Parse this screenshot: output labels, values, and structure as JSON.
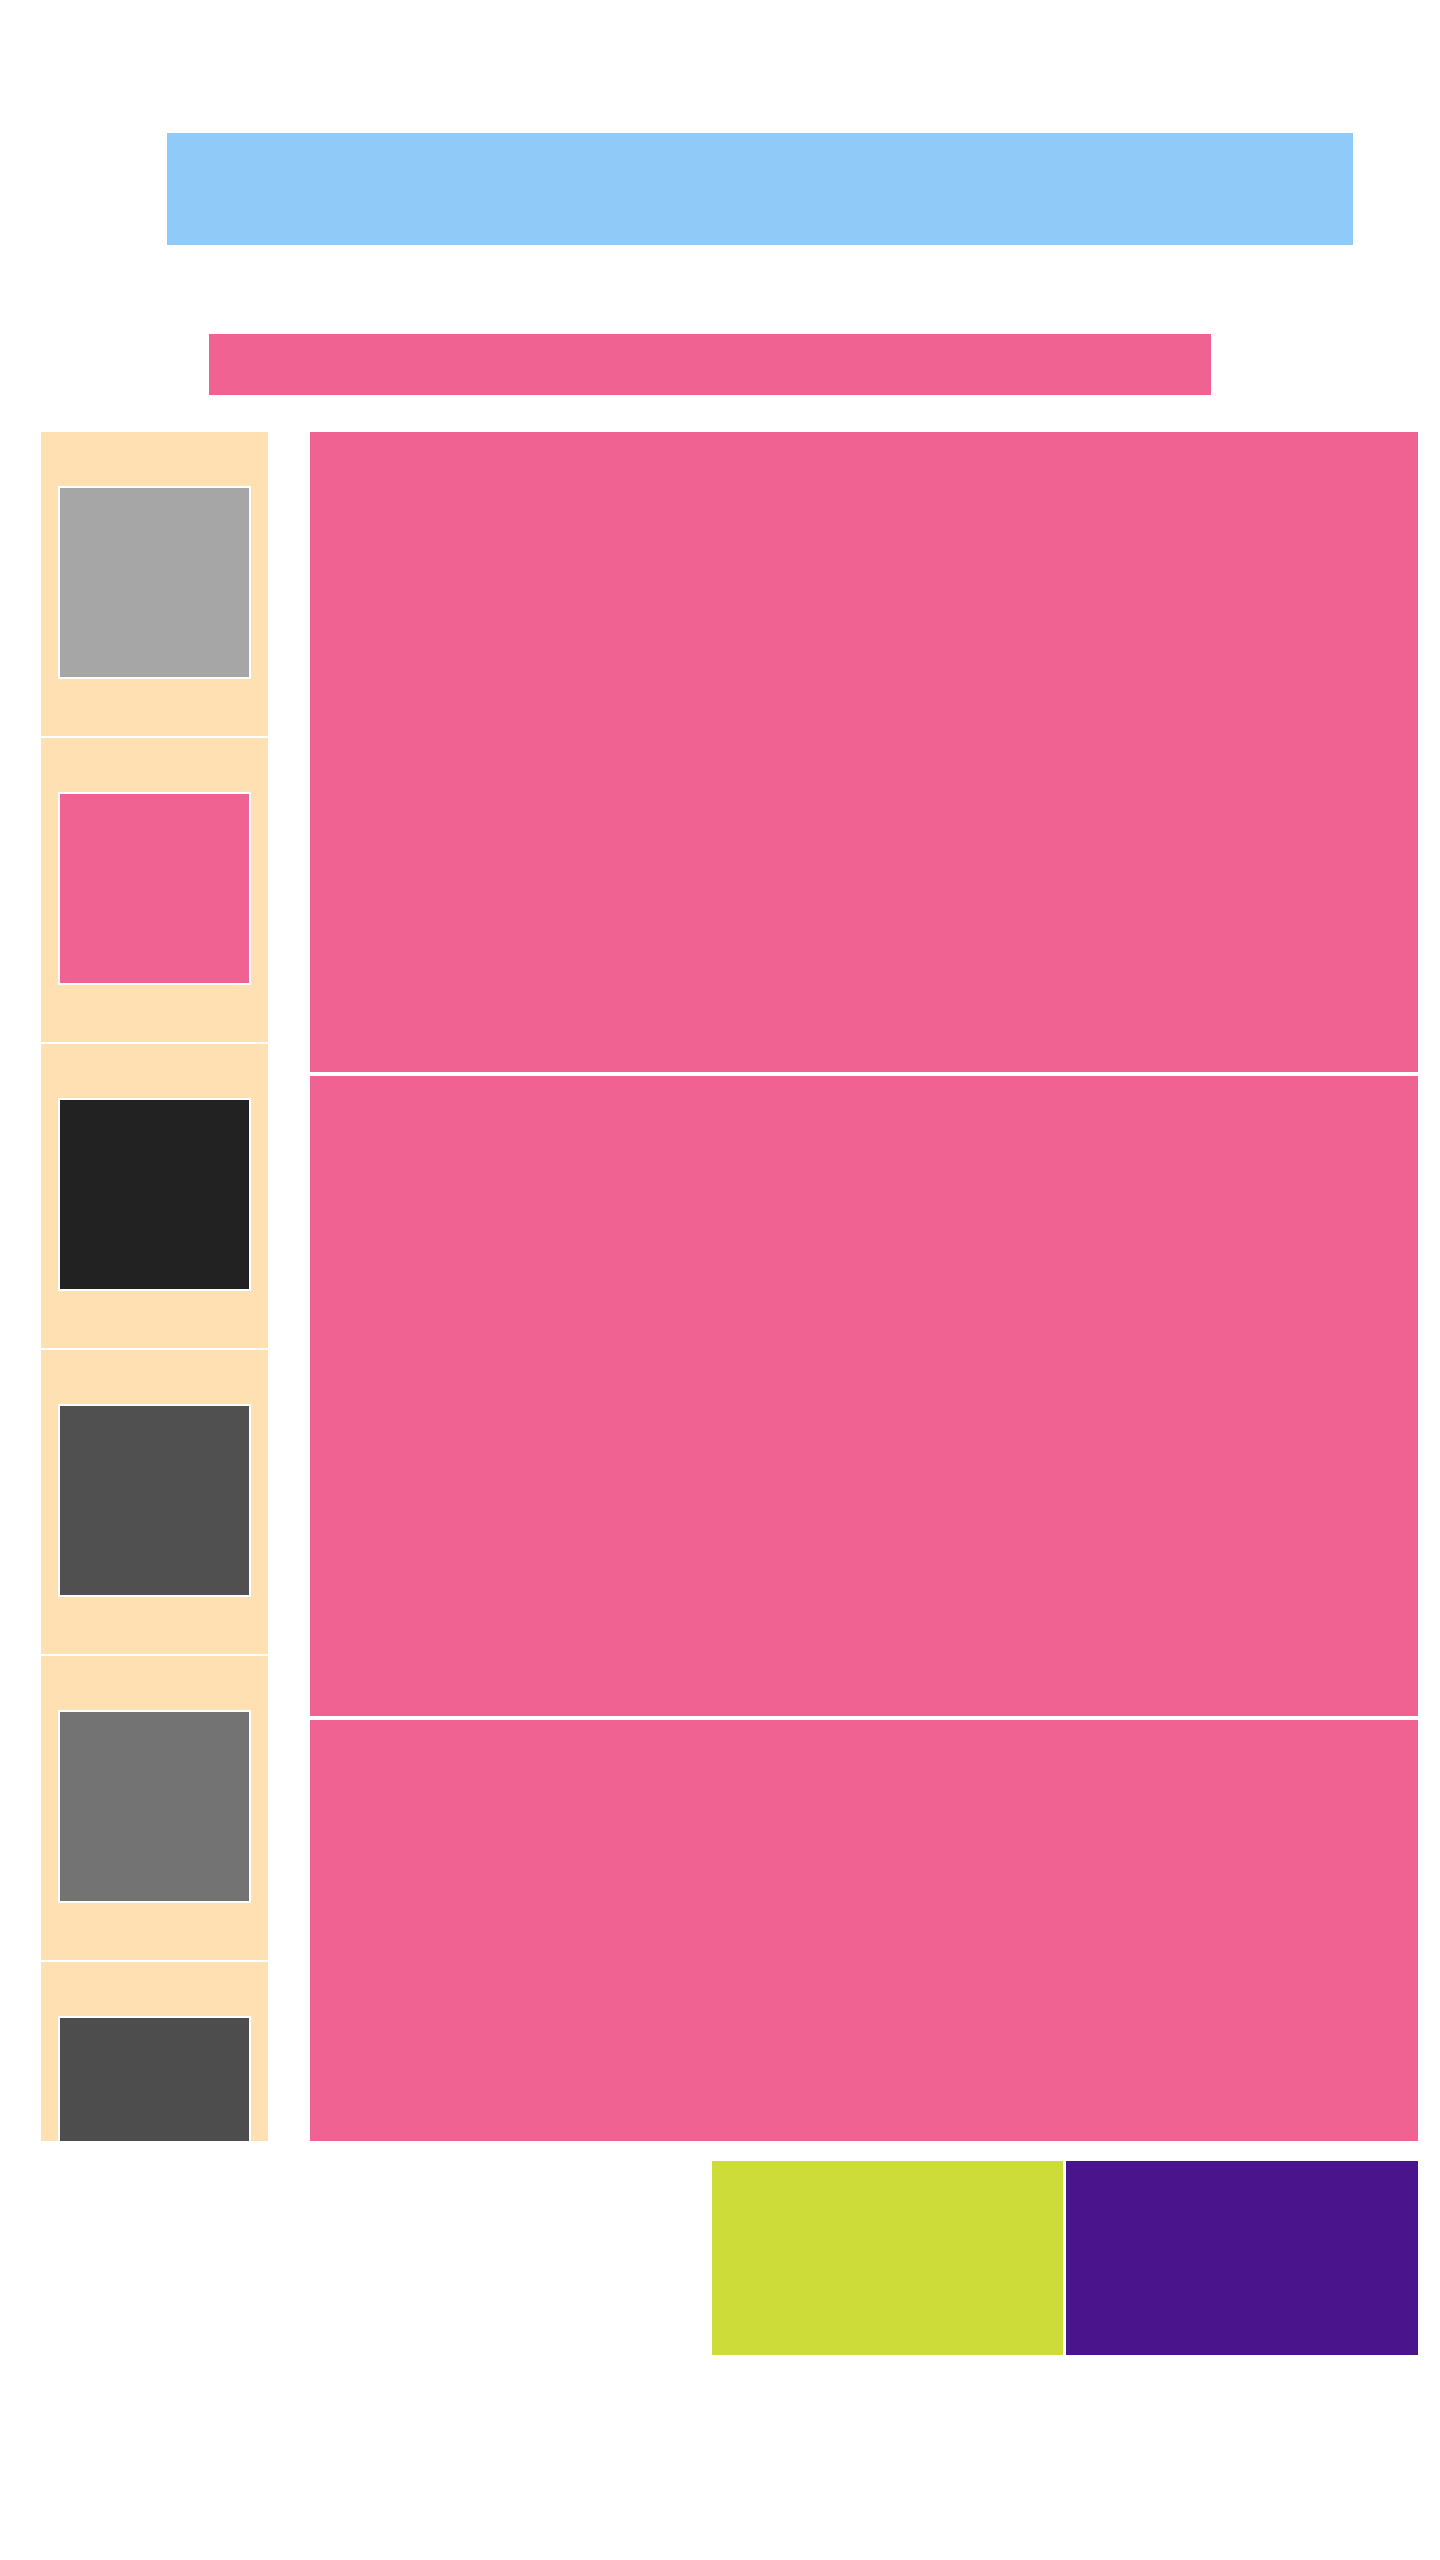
{
  "colors": {
    "hero_banner": "#90caf9",
    "title_bar": "#f06292",
    "thumb_rail_bg": "#ffe0b2",
    "panel": "#f06292",
    "tile_a": "#cddc39",
    "tile_b": "#4a148c"
  },
  "thumbnails": [
    {
      "name": "thumbnail-1",
      "color": "#a6a6a6"
    },
    {
      "name": "thumbnail-2",
      "color": "#f06292"
    },
    {
      "name": "thumbnail-3",
      "color": "#222222"
    },
    {
      "name": "thumbnail-4",
      "color": "#505050"
    },
    {
      "name": "thumbnail-5",
      "color": "#737373"
    },
    {
      "name": "thumbnail-6",
      "color": "#4d4d4d"
    }
  ],
  "panels": [
    {
      "name": "content-panel-1"
    },
    {
      "name": "content-panel-2"
    },
    {
      "name": "content-panel-3"
    }
  ]
}
